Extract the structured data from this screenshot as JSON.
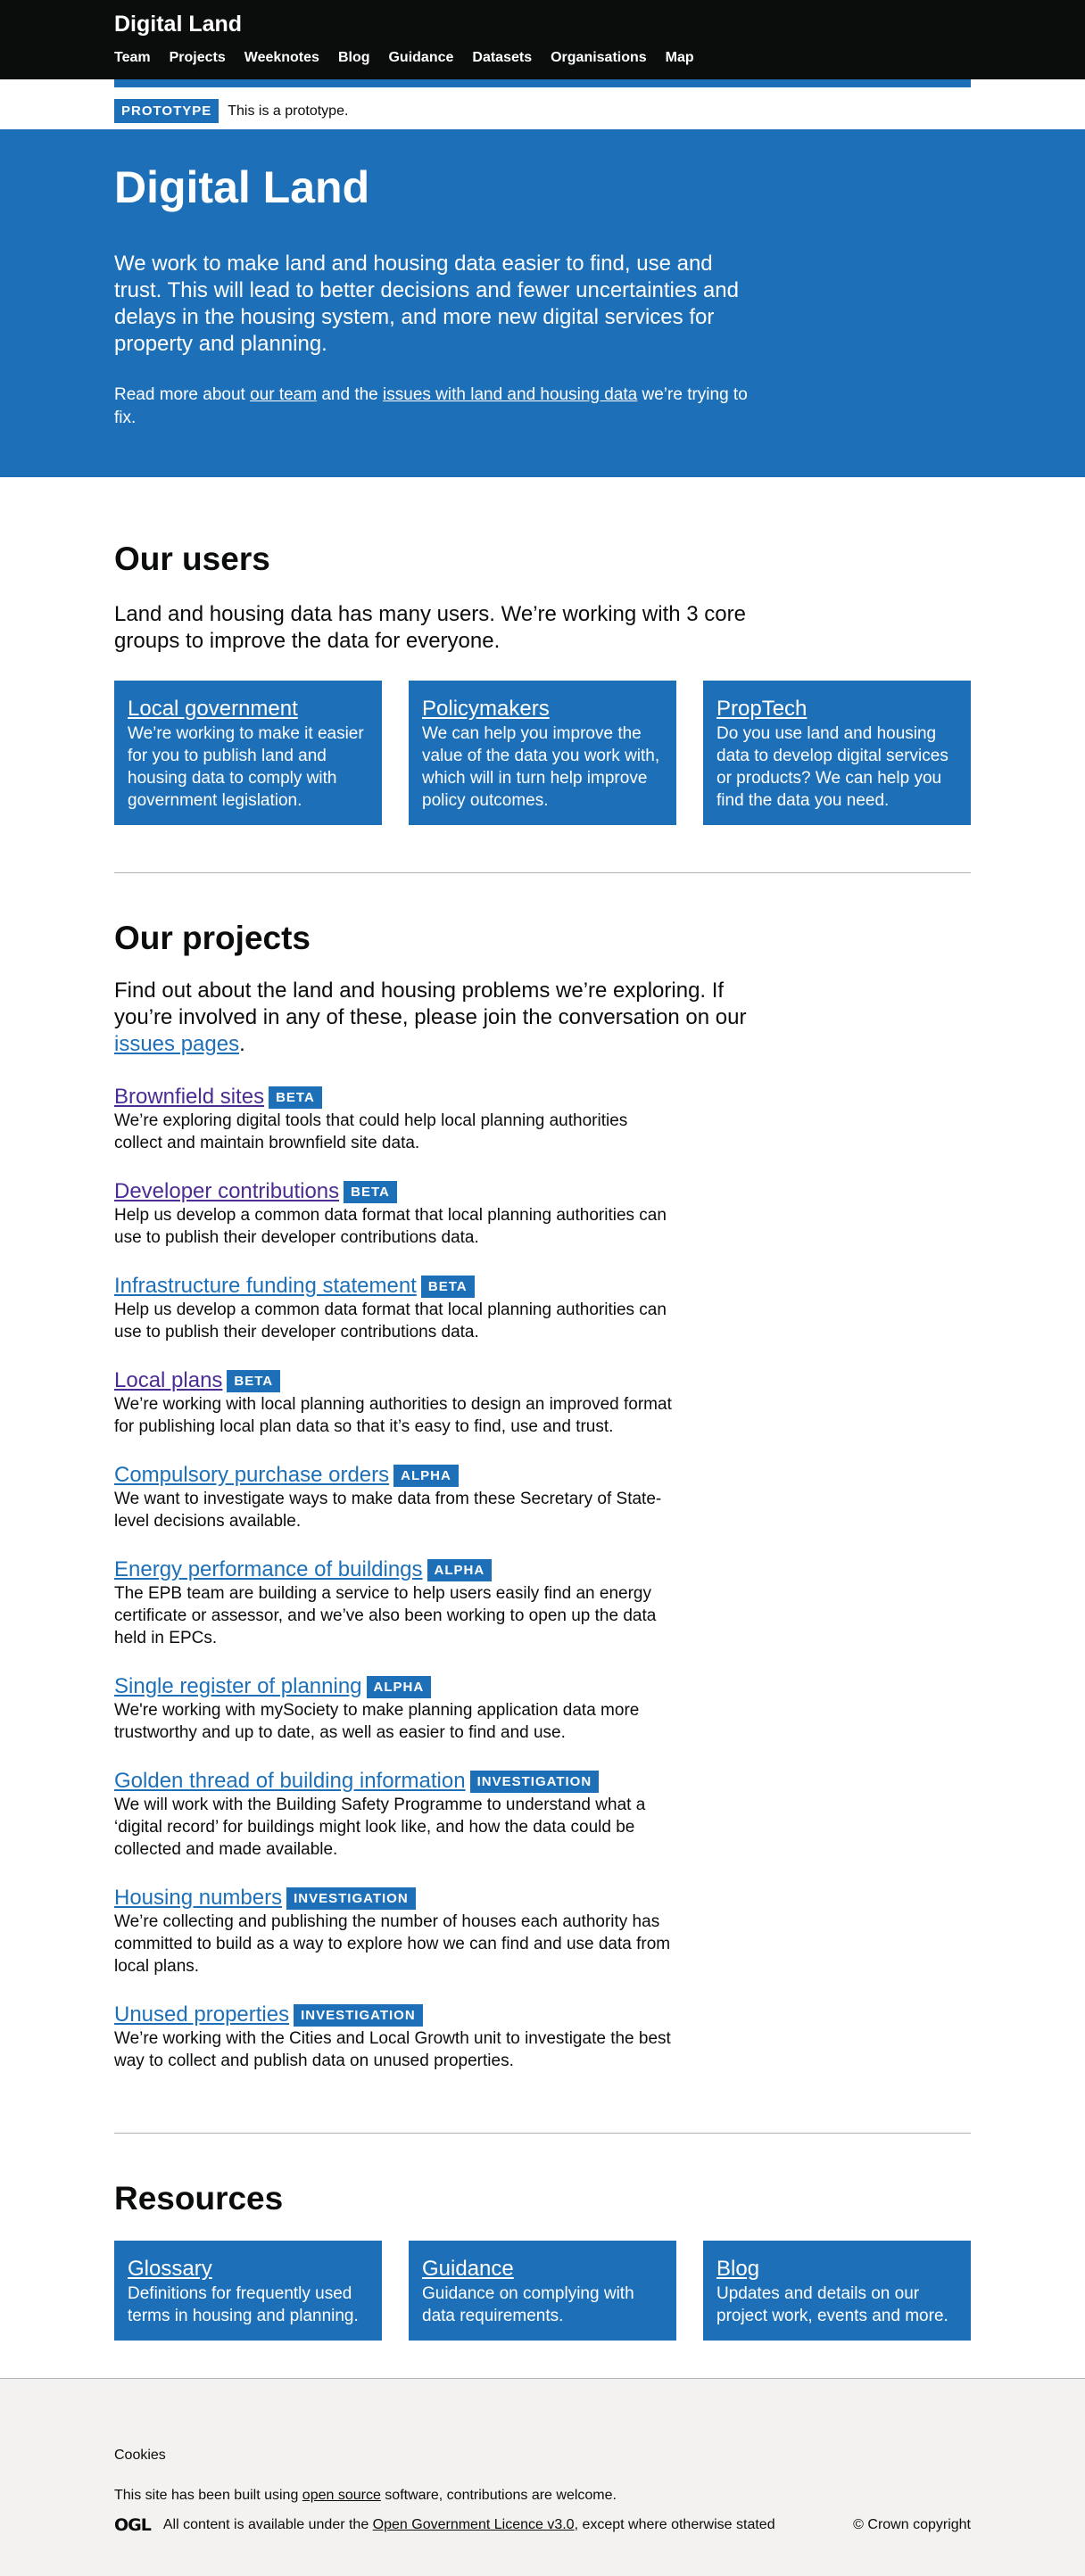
{
  "header": {
    "brand": "Digital Land",
    "nav": [
      "Team",
      "Projects",
      "Weeknotes",
      "Blog",
      "Guidance",
      "Datasets",
      "Organisations",
      "Map"
    ]
  },
  "phase": {
    "tag": "PROTOTYPE",
    "text": "This is a prototype."
  },
  "hero": {
    "title": "Digital Land",
    "lead": "We work to make land and housing data easier to find, use and trust. This will lead to better decisions and fewer uncertainties and delays in the housing system, and more new digital services for property and planning.",
    "more_prefix": "Read more about ",
    "team_link": "our team",
    "more_mid": " and the ",
    "issues_link": "issues with land and housing data",
    "more_suffix": " we’re trying to fix."
  },
  "users": {
    "title": "Our users",
    "lead": "Land and housing data has many users. We’re working with 3 core groups to improve the data for everyone.",
    "cards": [
      {
        "title": "Local government",
        "text": "We’re working to make it easier for you to publish land and housing data to comply with government legislation."
      },
      {
        "title": "Policymakers",
        "text": "We can help you improve the value of the data you work with, which will in turn help improve policy outcomes."
      },
      {
        "title": "PropTech",
        "text": "Do you use land and housing data to develop digital services or products? We can help you find the data you need."
      }
    ]
  },
  "projects": {
    "title": "Our projects",
    "lead_prefix": "Find out about the land and housing problems we’re exploring. If you’re involved in any of these, please join the conversation on our ",
    "lead_link": "issues pages",
    "lead_suffix": ".",
    "items": [
      {
        "title": "Brownfield sites",
        "tag": "BETA",
        "text": "We’re exploring digital tools that could help local planning authorities collect and maintain brownfield site data."
      },
      {
        "title": "Developer contributions",
        "tag": "BETA",
        "text": "Help us develop a common data format that local planning authorities can use to publish their developer contributions data."
      },
      {
        "title": "Infrastructure funding statement",
        "tag": "BETA",
        "text": "Help us develop a common data format that local planning authorities can use to publish their developer contributions data."
      },
      {
        "title": "Local plans",
        "tag": "BETA",
        "text": "We’re working with local planning authorities to design an improved format for publishing local plan data so that it’s easy to find, use and trust."
      },
      {
        "title": "Compulsory purchase orders",
        "tag": "ALPHA",
        "text": "We want to investigate ways to make data from these Secretary of State-level decisions available."
      },
      {
        "title": "Energy performance of buildings",
        "tag": "ALPHA",
        "text": "The EPB team are building a service to help users easily find an energy certificate or assessor, and we’ve also been working to open up the data held in EPCs."
      },
      {
        "title": "Single register of planning",
        "tag": "ALPHA",
        "text": "We're working with mySociety to make planning application data more trustworthy and up to date, as well as easier to find and use."
      },
      {
        "title": "Golden thread of building information",
        "tag": "INVESTIGATION",
        "text": "We will work with the Building Safety Programme to understand what a ‘digital record’ for buildings might look like, and how the data could be collected and made available."
      },
      {
        "title": "Housing numbers",
        "tag": "INVESTIGATION",
        "text": "We’re collecting and publishing the number of houses each authority has committed to build as a way to explore how we can find and use data from local plans."
      },
      {
        "title": "Unused properties",
        "tag": "INVESTIGATION",
        "text": "We’re working with the Cities and Local Growth unit to investigate the best way to collect and publish data on unused properties."
      }
    ]
  },
  "resources": {
    "title": "Resources",
    "cards": [
      {
        "title": "Glossary",
        "text": "Definitions for frequently used terms in housing and planning."
      },
      {
        "title": "Guidance",
        "text": "Guidance on complying with data requirements."
      },
      {
        "title": "Blog",
        "text": "Updates and details on our project work, events and more."
      }
    ]
  },
  "footer": {
    "cookies": "Cookies",
    "built_prefix": "This site has been built using ",
    "built_link": "open source",
    "built_suffix": " software, contributions are welcome.",
    "ogl_logo": "OGL",
    "licence_prefix": "All content is available under the ",
    "licence_link": "Open Government Licence v3.0",
    "licence_suffix": ", except where otherwise stated",
    "copyright": "© Crown copyright"
  },
  "colors": {
    "brand_blue": "#1d70b8",
    "header_black": "#0b0c0c",
    "visited_purple": "#4c2c92",
    "footer_grey": "#f3f2f1"
  }
}
